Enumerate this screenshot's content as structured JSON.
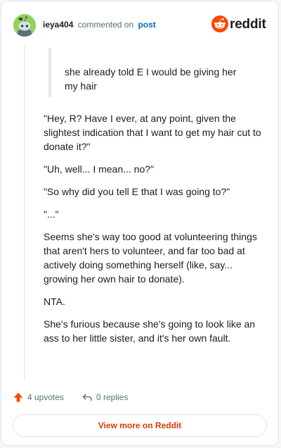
{
  "header": {
    "username": "ieya404",
    "action": "commented on",
    "post_link": "post",
    "brand_name": "reddit",
    "brand_color": "#ff4500"
  },
  "comment": {
    "quote": "she already told E I would be giving her my hair",
    "paragraphs": [
      "\"Hey, R? Have I ever, at any point, given the slightest indication that I want to get my hair cut to donate it?\"",
      "\"Uh, well... I mean... no?\"",
      "\"So why did you tell E that I was going to?\"",
      "\"...\"",
      "Seems she's way too good at volunteering things that aren't hers to volunteer, and far too bad at actively doing something herself (like, say... growing her own hair to donate).",
      "NTA.",
      "She's furious because she's going to look like an ass to her little sister, and it's her own fault."
    ]
  },
  "footer": {
    "upvotes": "4 upvotes",
    "replies": "0 replies",
    "upvote_color": "#ff4500"
  },
  "cta": {
    "label": "View more on Reddit",
    "color": "#d93a00"
  },
  "icons": [
    "snoo-avatar-icon",
    "reddit-logo-icon",
    "upvote-arrow-icon",
    "reply-arrow-icon"
  ]
}
